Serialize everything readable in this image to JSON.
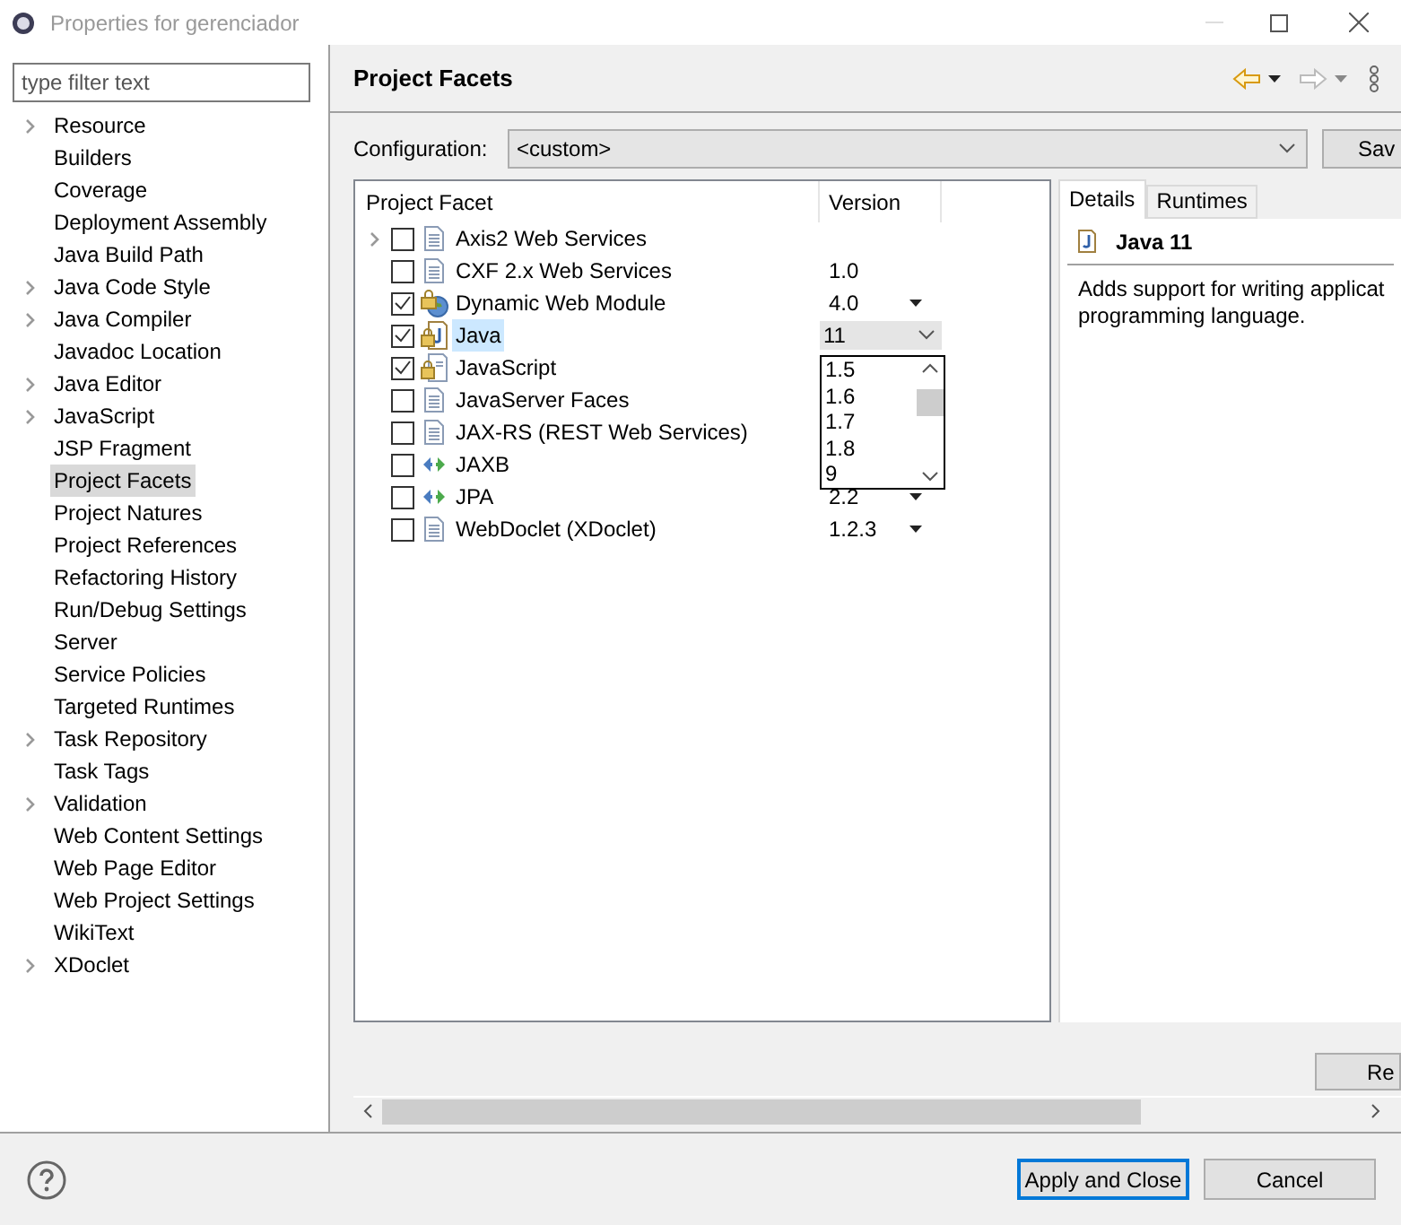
{
  "window": {
    "title": "Properties for gerenciador"
  },
  "filter": {
    "placeholder": "type filter text"
  },
  "tree": [
    {
      "label": "Resource",
      "expandable": true,
      "selected": false
    },
    {
      "label": "Builders",
      "expandable": false,
      "selected": false
    },
    {
      "label": "Coverage",
      "expandable": false,
      "selected": false
    },
    {
      "label": "Deployment Assembly",
      "expandable": false,
      "selected": false
    },
    {
      "label": "Java Build Path",
      "expandable": false,
      "selected": false
    },
    {
      "label": "Java Code Style",
      "expandable": true,
      "selected": false
    },
    {
      "label": "Java Compiler",
      "expandable": true,
      "selected": false
    },
    {
      "label": "Javadoc Location",
      "expandable": false,
      "selected": false
    },
    {
      "label": "Java Editor",
      "expandable": true,
      "selected": false
    },
    {
      "label": "JavaScript",
      "expandable": true,
      "selected": false
    },
    {
      "label": "JSP Fragment",
      "expandable": false,
      "selected": false
    },
    {
      "label": "Project Facets",
      "expandable": false,
      "selected": true
    },
    {
      "label": "Project Natures",
      "expandable": false,
      "selected": false
    },
    {
      "label": "Project References",
      "expandable": false,
      "selected": false
    },
    {
      "label": "Refactoring History",
      "expandable": false,
      "selected": false
    },
    {
      "label": "Run/Debug Settings",
      "expandable": false,
      "selected": false
    },
    {
      "label": "Server",
      "expandable": false,
      "selected": false
    },
    {
      "label": "Service Policies",
      "expandable": false,
      "selected": false
    },
    {
      "label": "Targeted Runtimes",
      "expandable": false,
      "selected": false
    },
    {
      "label": "Task Repository",
      "expandable": true,
      "selected": false
    },
    {
      "label": "Task Tags",
      "expandable": false,
      "selected": false
    },
    {
      "label": "Validation",
      "expandable": true,
      "selected": false
    },
    {
      "label": "Web Content Settings",
      "expandable": false,
      "selected": false
    },
    {
      "label": "Web Page Editor",
      "expandable": false,
      "selected": false
    },
    {
      "label": "Web Project Settings",
      "expandable": false,
      "selected": false
    },
    {
      "label": "WikiText",
      "expandable": false,
      "selected": false
    },
    {
      "label": "XDoclet",
      "expandable": true,
      "selected": false
    }
  ],
  "page": {
    "title": "Project Facets"
  },
  "configuration": {
    "label": "Configuration:",
    "value": "<custom>",
    "button": "Sav"
  },
  "table": {
    "columns": [
      "Project Facet",
      "Version"
    ],
    "rows": [
      {
        "name": "Axis2 Web Services",
        "kind": "doc",
        "checked": false,
        "expandable": true,
        "selected": false
      },
      {
        "name": "CXF 2.x Web Services",
        "kind": "doc",
        "checked": false,
        "expandable": false,
        "selected": false,
        "version": "1.0",
        "dropdown": false
      },
      {
        "name": "Dynamic Web Module",
        "kind": "globe",
        "checked": true,
        "expandable": false,
        "selected": false,
        "version": "4.0",
        "dropdown": true
      },
      {
        "name": "Java",
        "kind": "java",
        "checked": true,
        "expandable": false,
        "selected": true,
        "version": "11"
      },
      {
        "name": "JavaScript",
        "kind": "locked",
        "checked": true,
        "expandable": false,
        "selected": false
      },
      {
        "name": "JavaServer Faces",
        "kind": "doc",
        "checked": false,
        "expandable": false,
        "selected": false
      },
      {
        "name": "JAX-RS (REST Web Services)",
        "kind": "doc",
        "checked": false,
        "expandable": false,
        "selected": false
      },
      {
        "name": "JAXB",
        "kind": "arrows",
        "checked": false,
        "expandable": false,
        "selected": false
      },
      {
        "name": "JPA",
        "kind": "arrows",
        "checked": false,
        "expandable": false,
        "selected": false,
        "version": "2.2",
        "dropdown": true
      },
      {
        "name": "WebDoclet (XDoclet)",
        "kind": "doc",
        "checked": false,
        "expandable": false,
        "selected": false,
        "version": "1.2.3",
        "dropdown": true
      }
    ]
  },
  "version_list": {
    "options": [
      "1.5",
      "1.6",
      "1.7",
      "1.8",
      "9"
    ]
  },
  "details": {
    "tabs": [
      {
        "label": "Details",
        "selected": true
      },
      {
        "label": "Runtimes",
        "selected": false
      }
    ],
    "title": "Java 11",
    "description": "Adds support for writing applicat programming language."
  },
  "side_button": "Re",
  "buttons": [
    {
      "label": "Apply and Close",
      "default": true
    },
    {
      "label": "Cancel",
      "default": false
    }
  ]
}
